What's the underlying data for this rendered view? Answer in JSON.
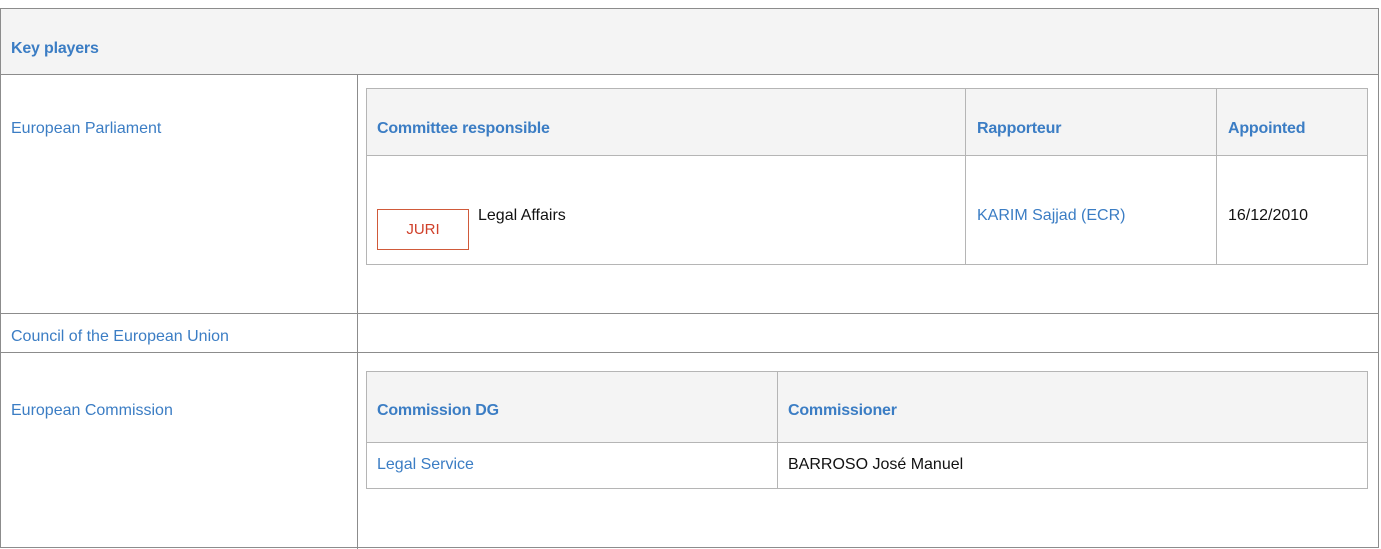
{
  "key_players": {
    "title": "Key players",
    "european_parliament": {
      "label": "European Parliament",
      "columns": {
        "committee": "Committee responsible",
        "rapporteur": "Rapporteur",
        "appointed": "Appointed"
      },
      "row": {
        "committee_code": "JURI",
        "committee_name": "Legal Affairs",
        "rapporteur": "KARIM Sajjad (ECR)",
        "appointed": "16/12/2010"
      }
    },
    "council": {
      "label": "Council of the European Union"
    },
    "european_commission": {
      "label": "European Commission",
      "columns": {
        "dg": "Commission DG",
        "commissioner": "Commissioner"
      },
      "row": {
        "dg": "Legal Service",
        "commissioner": "BARROSO José Manuel"
      }
    }
  },
  "colors": {
    "link": "#3b7dc4",
    "header_bg": "#f4f4f4",
    "border": "#8c8c8c",
    "badge": "#d05a3a"
  }
}
